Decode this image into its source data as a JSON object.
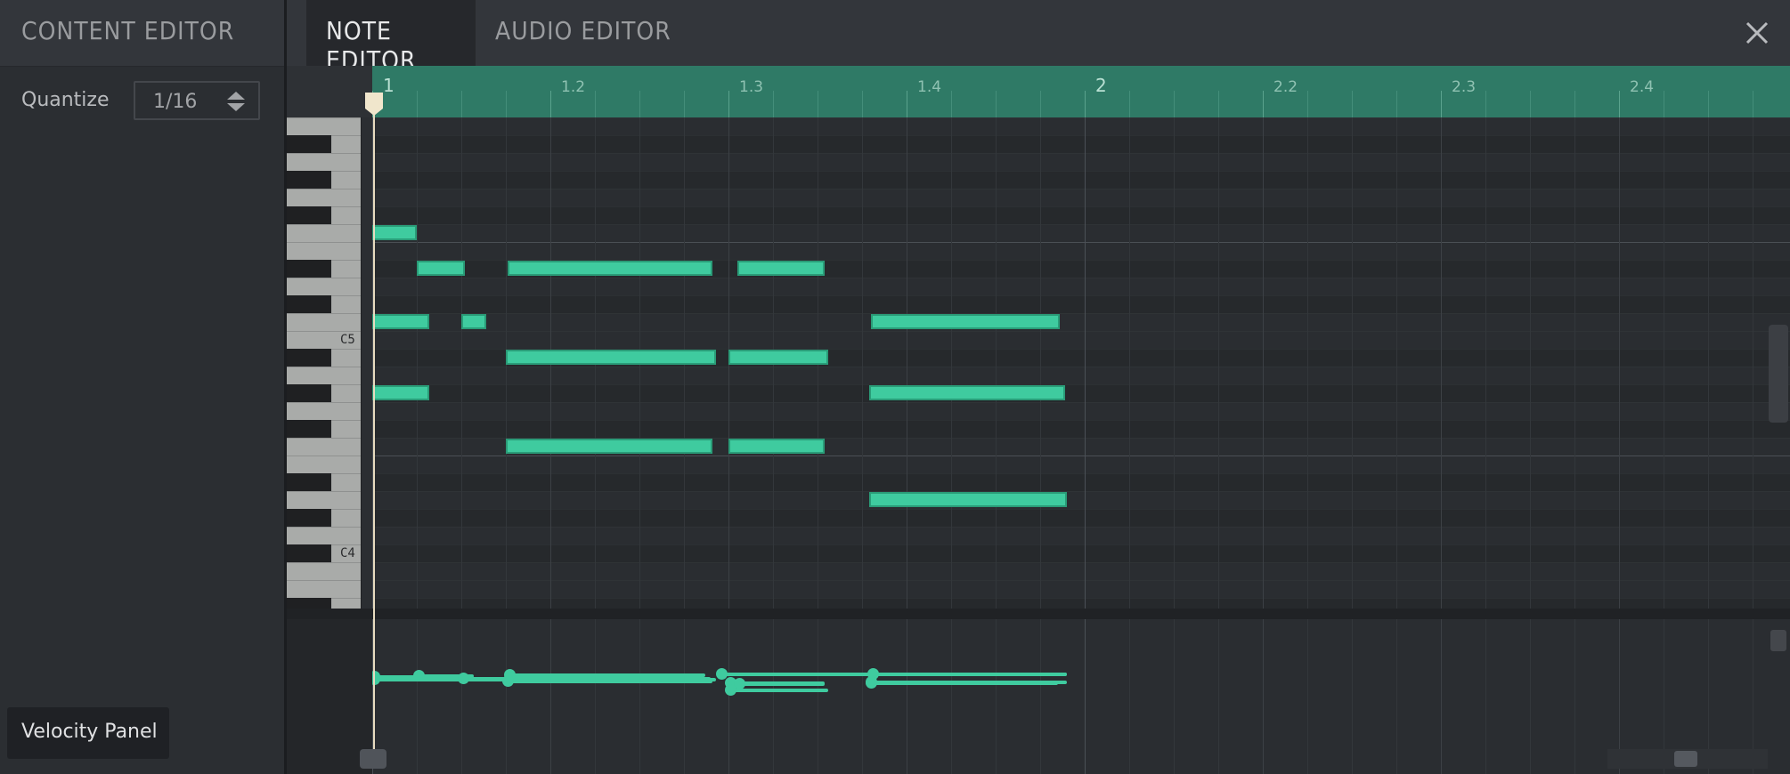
{
  "left_panel": {
    "title": "CONTENT EDITOR",
    "quantize_label": "Quantize",
    "quantize_value": "1/16",
    "velocity_button": "Velocity Panel"
  },
  "tabs": [
    {
      "label": "NOTE EDITOR",
      "active": true
    },
    {
      "label": "AUDIO EDITOR",
      "active": false
    }
  ],
  "icons": {
    "close": "close-icon",
    "stepper": "up-down-arrows-icon",
    "playhead": "playhead-marker-icon"
  },
  "ruler": {
    "labels": [
      {
        "text": "1",
        "beat": 0,
        "major": true
      },
      {
        "text": "1.2",
        "beat": 1,
        "major": false
      },
      {
        "text": "1.3",
        "beat": 2,
        "major": false
      },
      {
        "text": "1.4",
        "beat": 3,
        "major": false
      },
      {
        "text": "2",
        "beat": 4,
        "major": true
      },
      {
        "text": "2.2",
        "beat": 5,
        "major": false
      },
      {
        "text": "2.3",
        "beat": 6,
        "major": false
      },
      {
        "text": "2.4",
        "beat": 7,
        "major": false
      }
    ]
  },
  "keyboard": {
    "labels": [
      "C5",
      "C4"
    ]
  },
  "colors": {
    "accent": "#3fcb9f",
    "ruler": "#2f7a66",
    "background": "#2b2e32"
  },
  "notes": [
    {
      "start": 0.0,
      "length": 0.25,
      "row": 6
    },
    {
      "start": 0.25,
      "length": 0.27,
      "row": 8
    },
    {
      "start": 0.76,
      "length": 1.15,
      "row": 8
    },
    {
      "start": 2.05,
      "length": 0.49,
      "row": 8
    },
    {
      "start": 0.0,
      "length": 0.32,
      "row": 11
    },
    {
      "start": 0.5,
      "length": 0.14,
      "row": 11
    },
    {
      "start": 2.8,
      "length": 1.06,
      "row": 11
    },
    {
      "start": 0.75,
      "length": 1.18,
      "row": 13
    },
    {
      "start": 2.0,
      "length": 0.56,
      "row": 13
    },
    {
      "start": 0.0,
      "length": 0.32,
      "row": 15
    },
    {
      "start": 2.79,
      "length": 1.1,
      "row": 15
    },
    {
      "start": 0.75,
      "length": 1.16,
      "row": 18
    },
    {
      "start": 2.0,
      "length": 0.54,
      "row": 18
    },
    {
      "start": 2.79,
      "length": 1.11,
      "row": 21
    }
  ],
  "velocities": [
    {
      "start": 0.0,
      "length": 0.32,
      "level": 0.95
    },
    {
      "start": 0.0,
      "length": 0.52,
      "level": 0.93
    },
    {
      "start": 0.25,
      "length": 0.32,
      "level": 0.96
    },
    {
      "start": 0.0,
      "length": 1.93,
      "level": 0.9
    },
    {
      "start": 0.5,
      "length": 1.4,
      "level": 0.92
    },
    {
      "start": 0.76,
      "length": 1.11,
      "level": 0.98
    },
    {
      "start": 0.75,
      "length": 1.16,
      "level": 0.86
    },
    {
      "start": 1.95,
      "length": 1.95,
      "level": 1.0
    },
    {
      "start": 2.8,
      "length": 1.1,
      "level": 1.0
    },
    {
      "start": 2.0,
      "length": 0.54,
      "level": 0.84
    },
    {
      "start": 2.05,
      "length": 0.49,
      "level": 0.82
    },
    {
      "start": 2.0,
      "length": 0.56,
      "level": 0.7
    },
    {
      "start": 2.79,
      "length": 1.11,
      "level": 0.85
    },
    {
      "start": 2.79,
      "length": 1.06,
      "level": 0.83
    }
  ]
}
